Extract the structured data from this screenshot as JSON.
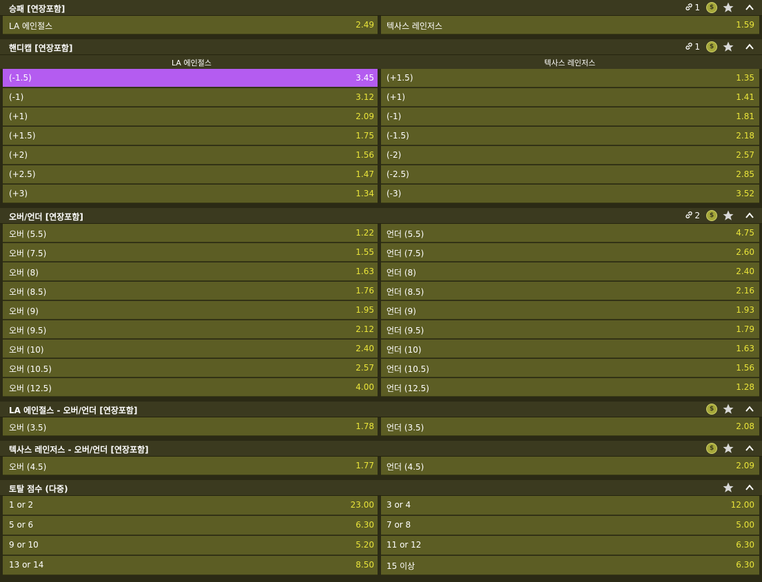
{
  "icons": {
    "link": "link-icon",
    "coin": "coin-icon",
    "star": "star-icon",
    "collapse": "chevron-up-icon",
    "coin_glyph": "$"
  },
  "colors": {
    "row_bg": "#5c5d24",
    "header_bg": "#3b3a1f",
    "odds": "#e9e43a",
    "selected": "#b45cf0"
  },
  "markets": [
    {
      "title": "승패 [연장포함]",
      "link_count": "1",
      "coin": true,
      "rows": [
        {
          "left": {
            "label": "LA 에인절스",
            "odds": "2.49"
          },
          "right": {
            "label": "텍사스 레인저스",
            "odds": "1.59"
          }
        }
      ]
    },
    {
      "title": "핸디캡 [연장포함]",
      "link_count": "1",
      "coin": true,
      "columns": [
        "LA 에인절스",
        "텍사스 레인저스"
      ],
      "rows": [
        {
          "left": {
            "label": "(-1.5)",
            "odds": "3.45",
            "selected": true
          },
          "right": {
            "label": "(+1.5)",
            "odds": "1.35"
          }
        },
        {
          "left": {
            "label": "(-1)",
            "odds": "3.12"
          },
          "right": {
            "label": "(+1)",
            "odds": "1.41"
          }
        },
        {
          "left": {
            "label": "(+1)",
            "odds": "2.09"
          },
          "right": {
            "label": "(-1)",
            "odds": "1.81"
          }
        },
        {
          "left": {
            "label": "(+1.5)",
            "odds": "1.75"
          },
          "right": {
            "label": "(-1.5)",
            "odds": "2.18"
          }
        },
        {
          "left": {
            "label": "(+2)",
            "odds": "1.56"
          },
          "right": {
            "label": "(-2)",
            "odds": "2.57"
          }
        },
        {
          "left": {
            "label": "(+2.5)",
            "odds": "1.47"
          },
          "right": {
            "label": "(-2.5)",
            "odds": "2.85"
          }
        },
        {
          "left": {
            "label": "(+3)",
            "odds": "1.34"
          },
          "right": {
            "label": "(-3)",
            "odds": "3.52"
          }
        }
      ]
    },
    {
      "title": "오버/언더 [연장포함]",
      "link_count": "2",
      "coin": true,
      "rows": [
        {
          "left": {
            "label": "오버 (5.5)",
            "odds": "1.22"
          },
          "right": {
            "label": "언더 (5.5)",
            "odds": "4.75"
          }
        },
        {
          "left": {
            "label": "오버 (7.5)",
            "odds": "1.55"
          },
          "right": {
            "label": "언더 (7.5)",
            "odds": "2.60"
          }
        },
        {
          "left": {
            "label": "오버 (8)",
            "odds": "1.63"
          },
          "right": {
            "label": "언더 (8)",
            "odds": "2.40"
          }
        },
        {
          "left": {
            "label": "오버 (8.5)",
            "odds": "1.76"
          },
          "right": {
            "label": "언더 (8.5)",
            "odds": "2.16"
          }
        },
        {
          "left": {
            "label": "오버 (9)",
            "odds": "1.95"
          },
          "right": {
            "label": "언더 (9)",
            "odds": "1.93"
          }
        },
        {
          "left": {
            "label": "오버 (9.5)",
            "odds": "2.12"
          },
          "right": {
            "label": "언더 (9.5)",
            "odds": "1.79"
          }
        },
        {
          "left": {
            "label": "오버 (10)",
            "odds": "2.40"
          },
          "right": {
            "label": "언더 (10)",
            "odds": "1.63"
          }
        },
        {
          "left": {
            "label": "오버 (10.5)",
            "odds": "2.57"
          },
          "right": {
            "label": "언더 (10.5)",
            "odds": "1.56"
          }
        },
        {
          "left": {
            "label": "오버 (12.5)",
            "odds": "4.00"
          },
          "right": {
            "label": "언더 (12.5)",
            "odds": "1.28"
          }
        }
      ]
    },
    {
      "title": "LA 에인절스 - 오버/언더 [연장포함]",
      "link_count": "",
      "coin": true,
      "rows": [
        {
          "left": {
            "label": "오버 (3.5)",
            "odds": "1.78"
          },
          "right": {
            "label": "언더 (3.5)",
            "odds": "2.08"
          }
        }
      ]
    },
    {
      "title": "텍사스 레인저스 - 오버/언더 [연장포함]",
      "link_count": "",
      "coin": true,
      "rows": [
        {
          "left": {
            "label": "오버 (4.5)",
            "odds": "1.77"
          },
          "right": {
            "label": "언더 (4.5)",
            "odds": "2.09"
          }
        }
      ]
    },
    {
      "title": "토탈 점수 (다중)",
      "link_count": "",
      "coin": false,
      "rows": [
        {
          "left": {
            "label": "1 or 2",
            "odds": "23.00"
          },
          "right": {
            "label": "3 or 4",
            "odds": "12.00"
          }
        },
        {
          "left": {
            "label": "5 or 6",
            "odds": "6.30"
          },
          "right": {
            "label": "7 or 8",
            "odds": "5.00"
          }
        },
        {
          "left": {
            "label": "9 or 10",
            "odds": "5.20"
          },
          "right": {
            "label": "11 or 12",
            "odds": "6.30"
          }
        },
        {
          "left": {
            "label": "13 or 14",
            "odds": "8.50"
          },
          "right": {
            "label": "15 이상",
            "odds": "6.30"
          }
        }
      ]
    }
  ]
}
